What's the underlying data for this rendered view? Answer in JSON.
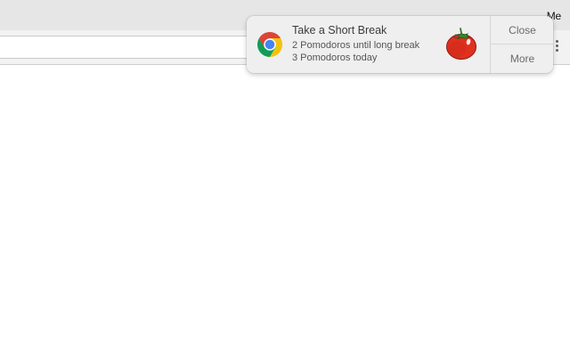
{
  "window": {
    "profile_label": "Me"
  },
  "notification": {
    "app_icon": "chrome-icon",
    "title": "Take a Short Break",
    "lines": [
      "2 Pomodoros until long break",
      "3 Pomodoros today"
    ],
    "image_icon": "tomato-icon",
    "actions": {
      "close_label": "Close",
      "more_label": "More"
    }
  },
  "colors": {
    "notification_bg": "#efefef",
    "tomato_red": "#e0301e",
    "chrome_red": "#db4437",
    "chrome_yellow": "#f4c20d",
    "chrome_green": "#0f9d58",
    "chrome_blue": "#4285f4"
  }
}
